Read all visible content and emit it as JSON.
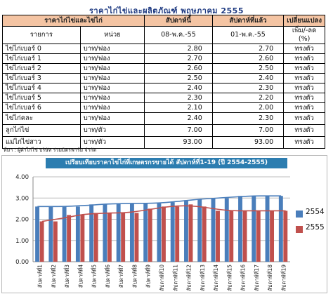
{
  "title": "ราคาไก่ไข่และผลิตภัณฑ์ พฤษภาคม 2555",
  "table": {
    "header1": [
      "ราคาไก่ไข่และไข่ไก่",
      "สัปดาห์นี้",
      "สัปดาห์ที่แล้ว",
      "เปลี่ยนแปลง"
    ],
    "header2": [
      "รายการ",
      "หน่วย",
      "08-พ.ค.-55",
      "01-พ.ค.-55",
      "เพิ่ม/-ลด (%)"
    ],
    "rows": [
      {
        "item": "ไข่ไก่เบอร์ 0",
        "unit": "บาท/ฟอง",
        "this_week": "2.80",
        "last_week": "2.70",
        "change": "ทรงตัว"
      },
      {
        "item": "ไข่ไก่เบอร์ 1",
        "unit": "บาท/ฟอง",
        "this_week": "2.70",
        "last_week": "2.60",
        "change": "ทรงตัว"
      },
      {
        "item": "ไข่ไก่เบอร์ 2",
        "unit": "บาท/ฟอง",
        "this_week": "2.60",
        "last_week": "2.50",
        "change": "ทรงตัว"
      },
      {
        "item": "ไข่ไก่เบอร์ 3",
        "unit": "บาท/ฟอง",
        "this_week": "2.50",
        "last_week": "2.40",
        "change": "ทรงตัว"
      },
      {
        "item": "ไข่ไก่เบอร์ 4",
        "unit": "บาท/ฟอง",
        "this_week": "2.40",
        "last_week": "2.30",
        "change": "ทรงตัว"
      },
      {
        "item": "ไข่ไก่เบอร์ 5",
        "unit": "บาท/ฟอง",
        "this_week": "2.30",
        "last_week": "2.20",
        "change": "ทรงตัว"
      },
      {
        "item": "ไข่ไก่เบอร์ 6",
        "unit": "บาท/ฟอง",
        "this_week": "2.10",
        "last_week": "2.00",
        "change": "ทรงตัว"
      },
      {
        "item": "ไข่ไก่คละ",
        "unit": "บาท/ฟอง",
        "this_week": "2.40",
        "last_week": "2.30",
        "change": "ทรงตัว"
      },
      {
        "item": "ลูกไก่ไข่",
        "unit": "บาท/ตัว",
        "this_week": "7.00",
        "last_week": "7.00",
        "change": "ทรงตัว"
      },
      {
        "item": "แม่ไก่ไข่สาว",
        "unit": "บาท/ตัว",
        "this_week": "93.00",
        "last_week": "93.00",
        "change": "ทรงตัว"
      }
    ]
  },
  "source": "ที่มา : ผู้ค้าไก่ไข่ บริษัท ร่วมมิตรฟาร์ม จำกัด",
  "chart_data": {
    "type": "bar",
    "title": "เปรียบเทียบราคาไข่ไก่ที่เกษตรกรขายได้ สัปดาห์ที่1-19 (ปี 2554-2555)",
    "categories": [
      "สัปดาห์ที่1",
      "สัปดาห์ที่2",
      "สัปดาห์ที่3",
      "สัปดาห์ที่4",
      "สัปดาห์ที่5",
      "สัปดาห์ที่6",
      "สัปดาห์ที่7",
      "สัปดาห์ที่8",
      "สัปดาห์ที่9",
      "สัปดาห์ที่10",
      "สัปดาห์ที่11",
      "สัปดาห์ที่12",
      "สัปดาห์ที่13",
      "สัปดาห์ที่14",
      "สัปดาห์ที่15",
      "สัปดาห์ที่16",
      "สัปดาห์ที่17",
      "สัปดาห์ที่18",
      "สัปดาห์ที่19"
    ],
    "series": [
      {
        "name": "2554",
        "color": "#4a7ebb",
        "values": [
          2.6,
          2.6,
          2.6,
          2.6,
          2.7,
          2.7,
          2.75,
          2.75,
          2.75,
          2.75,
          2.8,
          2.9,
          2.95,
          3.0,
          3.0,
          3.1,
          3.1,
          3.1,
          3.1
        ]
      },
      {
        "name": "2555",
        "color": "#c0504d",
        "values": [
          1.9,
          1.9,
          2.2,
          2.2,
          2.3,
          2.3,
          2.3,
          2.3,
          2.5,
          2.6,
          2.6,
          2.7,
          2.6,
          2.4,
          2.4,
          2.4,
          2.4,
          2.4,
          2.4
        ]
      }
    ],
    "yticks": [
      "0.00",
      "1.00",
      "2.00",
      "3.00",
      "4.00"
    ],
    "ylim": [
      0,
      4
    ],
    "grid": true,
    "legend": "right",
    "trendlines": true
  }
}
